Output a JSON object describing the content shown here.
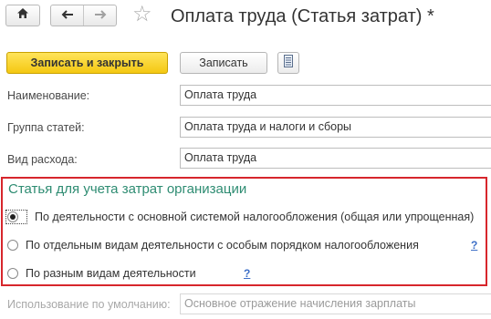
{
  "header": {
    "title": "Оплата труда (Статья затрат) *",
    "home_icon": "home-icon",
    "back_icon": "arrow-left-icon",
    "forward_icon": "arrow-right-icon",
    "favorite_icon": "star-icon"
  },
  "toolbar": {
    "save_close_label": "Записать и закрыть",
    "save_label": "Записать",
    "report_icon": "document-list-icon"
  },
  "form": {
    "name": {
      "label": "Наименование:",
      "value": "Оплата труда"
    },
    "group": {
      "label": "Группа статей:",
      "value": "Оплата труда и налоги и сборы"
    },
    "expense_type": {
      "label": "Вид расхода:",
      "value": "Оплата труда"
    },
    "default_usage": {
      "label": "Использование по умолчанию:",
      "value": "Основное отражение начисления зарплаты"
    }
  },
  "cost_group": {
    "title": "Статья для учета затрат организации",
    "options": [
      {
        "label": "По деятельности с основной системой налогообложения (общая или упрощенная)",
        "selected": true,
        "help": ""
      },
      {
        "label": "По отдельным видам деятельности с особым порядком налогообложения",
        "selected": false,
        "help": "?"
      },
      {
        "label": "По разным видам деятельности",
        "selected": false,
        "help": "?"
      }
    ]
  },
  "colors": {
    "accent_yellow": "#f4c812",
    "group_title": "#2e8c72",
    "highlight_border": "#d7262c",
    "help_link": "#3d6fc7"
  }
}
